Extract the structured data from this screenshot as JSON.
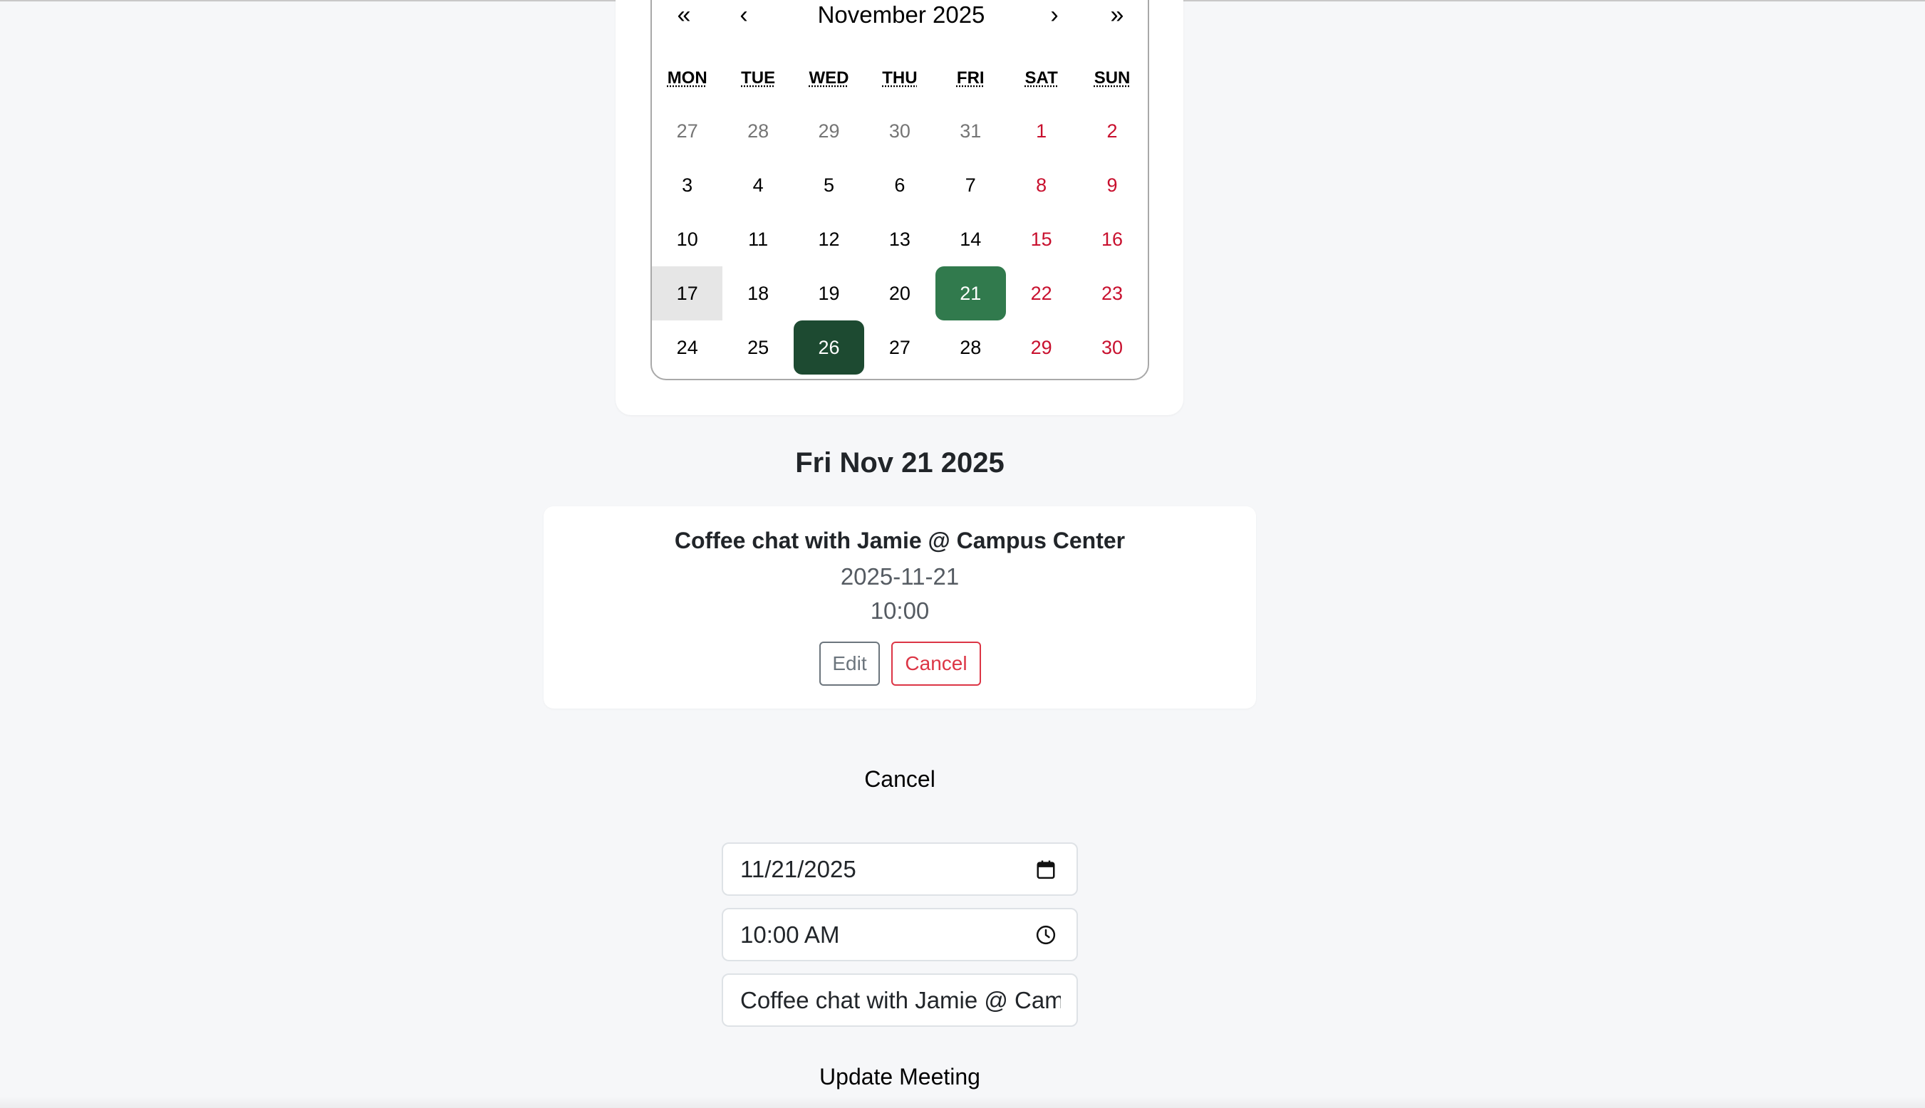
{
  "calendar": {
    "month_label": "November 2025",
    "nav": {
      "prev_year": "«",
      "prev_month": "‹",
      "next_month": "›",
      "next_year": "»"
    },
    "weekdays": [
      "MON",
      "TUE",
      "WED",
      "THU",
      "FRI",
      "SAT",
      "SUN"
    ],
    "weeks": [
      [
        "27",
        "28",
        "29",
        "30",
        "31",
        "1",
        "2"
      ],
      [
        "3",
        "4",
        "5",
        "6",
        "7",
        "8",
        "9"
      ],
      [
        "10",
        "11",
        "12",
        "13",
        "14",
        "15",
        "16"
      ],
      [
        "17",
        "18",
        "19",
        "20",
        "21",
        "22",
        "23"
      ],
      [
        "24",
        "25",
        "26",
        "27",
        "28",
        "29",
        "30"
      ]
    ],
    "today": "17",
    "selected": "21",
    "highlighted": "26",
    "colors": {
      "weekend": "#c8102e",
      "selected": "#317a4d",
      "highlighted": "#1d4a31",
      "today": "#e6e6e6"
    }
  },
  "selected_date_heading": "Fri Nov 21 2025",
  "meeting": {
    "title": "Coffee chat with Jamie @ Campus Center",
    "date": "2025-11-21",
    "time": "10:00",
    "edit_label": "Edit",
    "cancel_label": "Cancel"
  },
  "edit_form": {
    "cancel_label": "Cancel",
    "date_value": "11/21/2025",
    "time_value": "10:00 AM",
    "title_value": "Coffee chat with Jamie @ Campus Center",
    "update_label": "Update Meeting",
    "icons": {
      "date": "calendar-icon",
      "time": "clock-icon"
    }
  }
}
